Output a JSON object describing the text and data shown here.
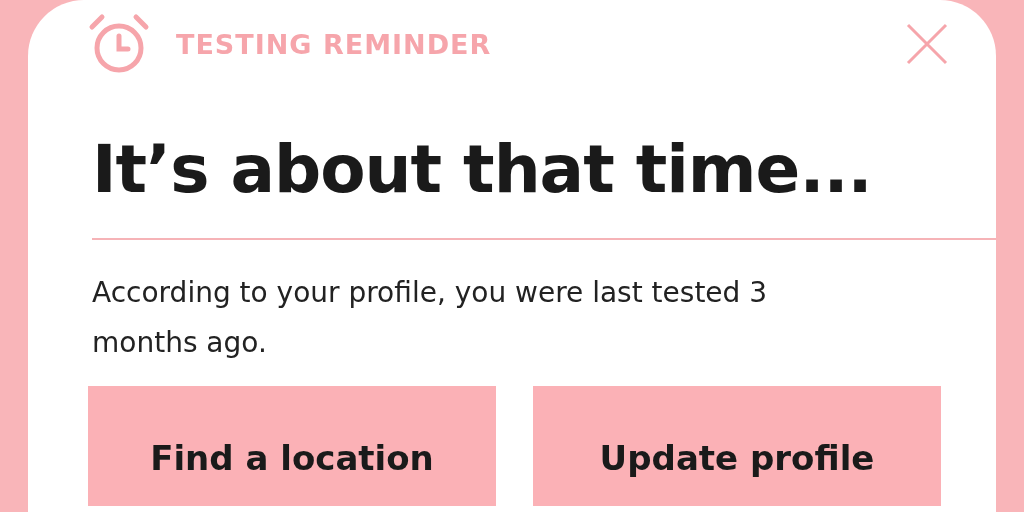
{
  "reminder": {
    "label": "TESTING REMINDER",
    "heading": "It’s about that time...",
    "message": "According to your profile, you were last tested 3 months ago."
  },
  "buttons": [
    {
      "label": "Find a location"
    },
    {
      "label": "Update profile"
    }
  ]
}
